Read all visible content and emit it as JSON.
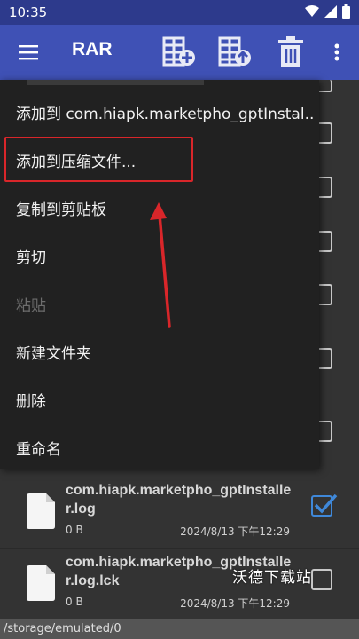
{
  "status": {
    "time": "10:35"
  },
  "app": {
    "title": "RAR"
  },
  "toolbar": {
    "icons": [
      "menu-icon",
      "add-archive-icon",
      "extract-archive-icon",
      "delete-icon",
      "more-vert-icon"
    ]
  },
  "context_menu": {
    "items": [
      {
        "label": "添加到 com.hiapk.marketpho_gptInstal..",
        "enabled": true
      },
      {
        "label": "添加到压缩文件...",
        "enabled": true
      },
      {
        "label": "复制到剪贴板",
        "enabled": true
      },
      {
        "label": "剪切",
        "enabled": true
      },
      {
        "label": "粘贴",
        "enabled": false
      },
      {
        "label": "新建文件夹",
        "enabled": true
      },
      {
        "label": "删除",
        "enabled": true
      },
      {
        "label": "重命名",
        "enabled": true
      }
    ]
  },
  "files": [
    {
      "name": "com.hiapk.marketpho_gptInstaller.log",
      "size": "0 B",
      "date": "2024/8/13 下午12:29",
      "checked": true
    },
    {
      "name": "com.hiapk.marketpho_gptInstaller.log.lck",
      "size": "0 B",
      "date": "2024/8/13 下午12:29",
      "checked": false
    }
  ],
  "watermark": "沃德下载站",
  "path": "/storage/emulated/0",
  "colors": {
    "toolbar": "#3f51b5",
    "statusbar": "#2d3a8c",
    "highlight": "#d9262a",
    "checkbox_checked": "#3f88d9"
  }
}
